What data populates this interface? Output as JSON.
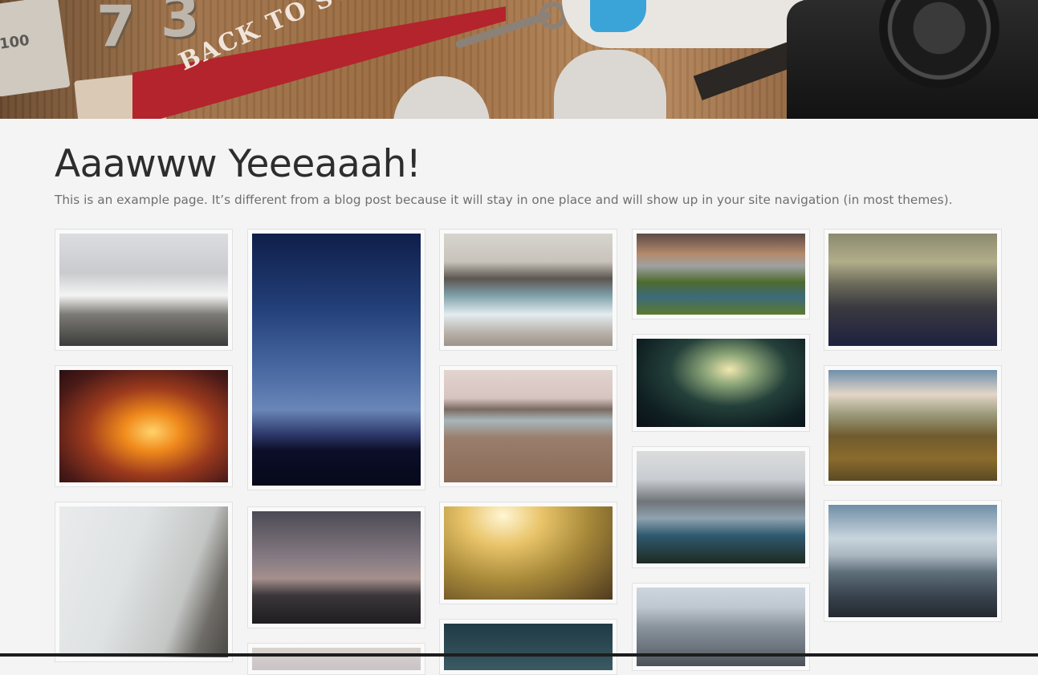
{
  "page": {
    "title": "Aaawww Yeeeaaah!",
    "description": "This is an example page. It’s different from a blog post because it will stay in one place and will show up in your site navigation (in most themes)."
  },
  "hero": {
    "pennant_text": "BACK TO SCHOOL",
    "numbers": [
      "7",
      "3"
    ],
    "side_text": "100"
  },
  "gallery": {
    "items": [
      {
        "name": "gallery-image-snowy-mountain-birds"
      },
      {
        "name": "gallery-image-canyon-glow"
      },
      {
        "name": "gallery-image-misty-cliff"
      },
      {
        "name": "gallery-image-milky-way"
      },
      {
        "name": "gallery-image-bridge-dusk"
      },
      {
        "name": "gallery-image-bottom-partial-2"
      },
      {
        "name": "gallery-image-ocean-rocks"
      },
      {
        "name": "gallery-image-lake-grassland"
      },
      {
        "name": "gallery-image-sunlit-meadow"
      },
      {
        "name": "gallery-image-bottom-partial-3"
      },
      {
        "name": "gallery-image-forest-lake"
      },
      {
        "name": "gallery-image-tree-road"
      },
      {
        "name": "gallery-image-mountain-lake"
      },
      {
        "name": "gallery-image-mountain-range"
      },
      {
        "name": "gallery-image-foggy-peak"
      },
      {
        "name": "gallery-image-green-hills"
      },
      {
        "name": "gallery-image-misty-valley"
      }
    ]
  }
}
